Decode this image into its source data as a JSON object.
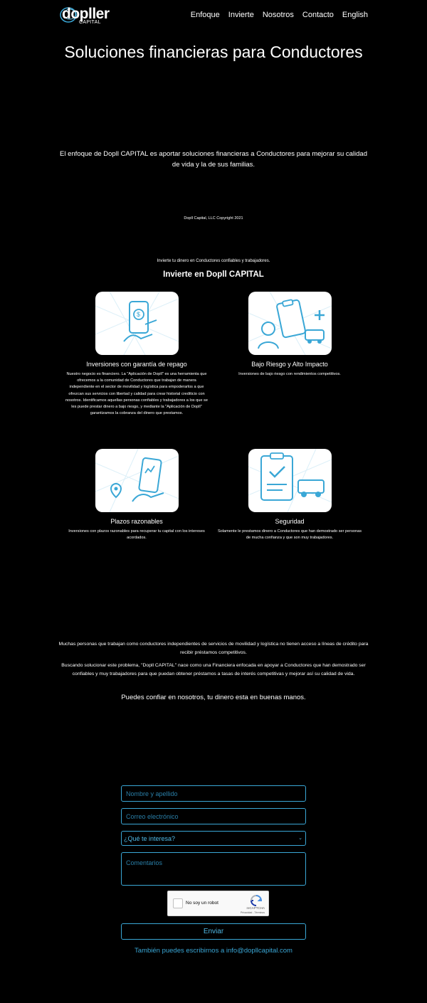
{
  "nav": {
    "logo_word": "dopller",
    "logo_sub": "CAPITAL",
    "items": [
      "Enfoque",
      "Invierte",
      "Nosotros",
      "Contacto",
      "English"
    ]
  },
  "hero": {
    "title": "Soluciones financieras para Conductores",
    "intro": "El enfoque de Dopll CAPITAL es aportar soluciones financieras a Conductores para mejorar su calidad de vida y la de sus familias.",
    "copyright": "Dopll Capital, LLC Copyright 2021"
  },
  "invest": {
    "subtitle": "Invierte tu dinero en Conductores confiables y trabajadores.",
    "title": "Invierte en Dopll CAPITAL",
    "cards": [
      {
        "icon": "phone-payment-icon",
        "title": "Inversiones con garantía de repago",
        "text": "Nuestro negocio es financiero. La \"Aplicación de Dopll\" es una herramienta que ofrecemos a la comunidad de Conductores que trabajan de manera independiente en el sector de movilidad y logística para empoderarlos a que ofrezcan sus servicios con libertad y calidad para crear historial crediticio con nosotros. Identificamos aquellas personas confiables y trabajadores a los que se les puede prestar dinero a bajo riesgo, y mediante la \"Aplicación de Dopll\" garantizamos la cobranza del dinero que prestamos."
      },
      {
        "icon": "clipboard-driver-icon",
        "title": "Bajo Riesgo y Alto Impacto",
        "text": "Inversiones de bajo riesgo con rendimientos competitivos."
      },
      {
        "icon": "phone-location-icon",
        "title": "Plazos razonables",
        "text": "Inversiones con plazos razonables para recuperar tu capital con los intereses acordados."
      },
      {
        "icon": "checklist-truck-icon",
        "title": "Seguridad",
        "text": "Solamente le prestamos dinero a Conductores que han demostrado ser personas de mucha confianza y que son muy trabajadores."
      }
    ]
  },
  "about": {
    "p1": "Muchas personas que trabajan como conductores independientes de servicios de movilidad y logística no tienen acceso a líneas de crédito para recibir préstamos competitivos.",
    "p2": "Buscando solucionar este problema, \"Dopll CAPITAL\" nace como una Financiera enfocada en apoyar a Conductores que han demostrado ser confiables y muy trabajadores para que puedan obtener préstamos a tasas de interés competitivas y mejorar así su calidad de vida.",
    "trust": "Puedes confiar en nosotros, tu dinero esta en buenas manos."
  },
  "form": {
    "name_placeholder": "Nombre y apellido",
    "email_placeholder": "Correo electrónico",
    "interest_value": "¿Qué te interesa?",
    "comments_placeholder": "Comentarios",
    "recaptcha_label": "No soy un robot",
    "recaptcha_brand": "reCAPTCHA",
    "recaptcha_terms": "Privacidad - Términos",
    "submit_label": "Enviar",
    "email_line": "También puedes escribirnos a info@dopllcapital.com"
  },
  "colors": {
    "accent": "#3aa7d6",
    "background": "#000000"
  }
}
